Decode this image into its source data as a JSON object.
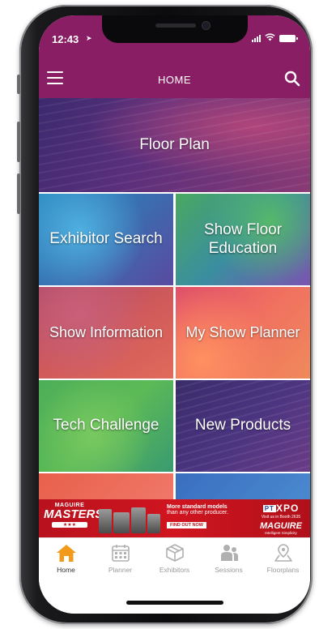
{
  "status_bar": {
    "time": "12:43"
  },
  "navbar": {
    "title": "HOME"
  },
  "tiles": {
    "floor_plan": "Floor Plan",
    "exhibitor_search": "Exhibitor Search",
    "show_floor_education": "Show Floor Education",
    "show_information": "Show Information",
    "my_show_planner": "My Show Planner",
    "tech_challenge": "Tech Challenge",
    "new_products": "New Products"
  },
  "ad_banner": {
    "logo_top": "MAGUIRE",
    "logo_main": "MASTERS",
    "headline": "More standard models",
    "subline": "than any other producer.",
    "cta": "FIND OUT NOW",
    "expo_prefix": "PT",
    "expo_name": "XPO",
    "booth": "Visit us in Booth 2635",
    "brand": "MAGUIRE",
    "brand_tagline": "Intelligent Simplicity"
  },
  "tab_bar": {
    "active": "Home",
    "tabs": [
      {
        "label": "Home",
        "icon": "home-icon"
      },
      {
        "label": "Planner",
        "icon": "calendar-icon"
      },
      {
        "label": "Exhibitors",
        "icon": "box-icon"
      },
      {
        "label": "Sessions",
        "icon": "people-icon"
      },
      {
        "label": "Floorplans",
        "icon": "map-pin-icon"
      }
    ]
  },
  "colors": {
    "header": "#8a1e64",
    "active_tab": "#f29a1c",
    "inactive_tab": "#b0b0b0",
    "ad_red": "#c8141e"
  }
}
